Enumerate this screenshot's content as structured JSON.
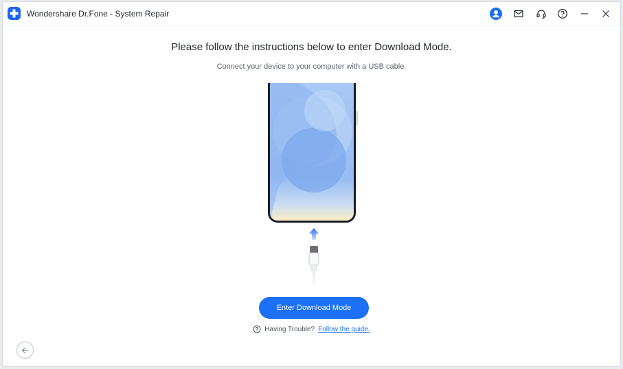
{
  "app": {
    "title": "Wondershare Dr.Fone - System Repair"
  },
  "titlebar": {
    "icons": [
      "account-icon",
      "mail-icon",
      "headset-icon",
      "help-icon",
      "minimize-icon",
      "close-icon"
    ]
  },
  "main": {
    "heading": "Please follow the instructions below to enter Download Mode.",
    "subheading": "Connect your device to your computer with a USB cable.",
    "cta_label": "Enter Download Mode",
    "trouble_text": "Having Trouble?",
    "guide_link": "Follow the guide."
  },
  "colors": {
    "accent": "#1b70f5",
    "logo": "#1a66f2",
    "text": "#1f2329"
  }
}
